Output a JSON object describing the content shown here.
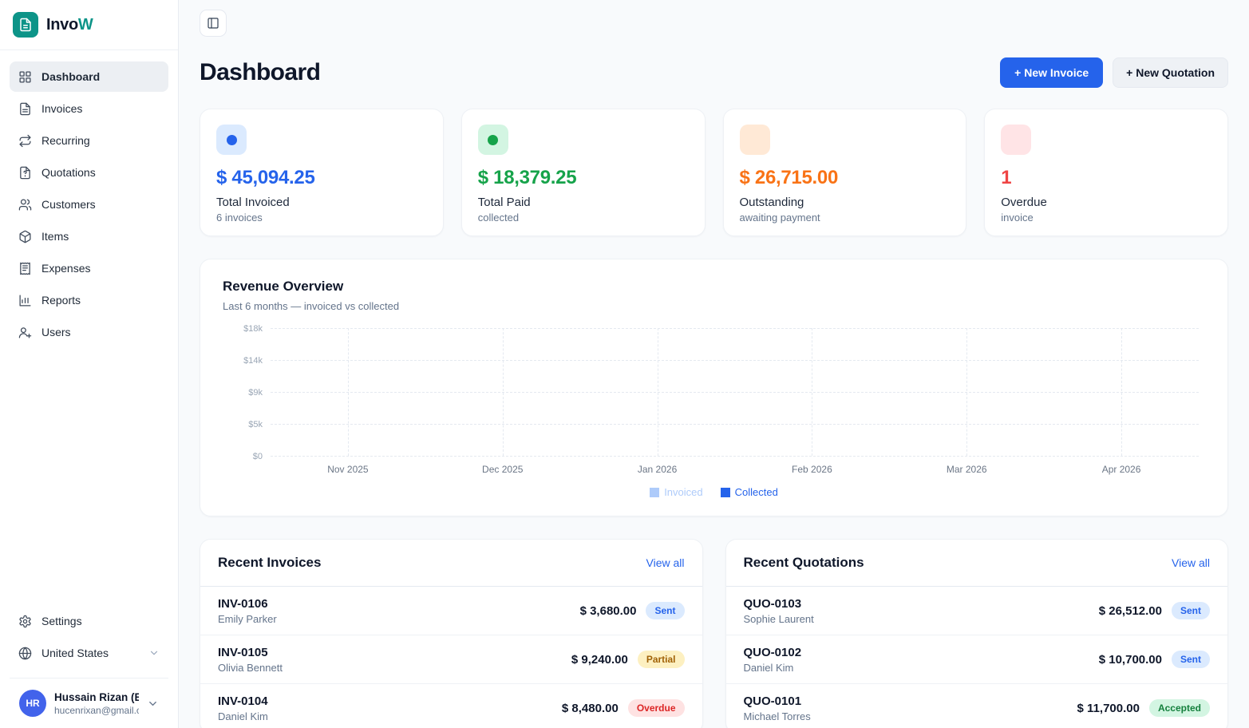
{
  "app": {
    "logo_primary": "Invo",
    "logo_secondary": "W"
  },
  "theme": {
    "brand_teal": "#0d9488",
    "primary_blue": "#2563eb"
  },
  "sidebar": {
    "items": [
      {
        "label": "Dashboard",
        "active": true
      },
      {
        "label": "Invoices"
      },
      {
        "label": "Recurring"
      },
      {
        "label": "Quotations"
      },
      {
        "label": "Customers"
      },
      {
        "label": "Items"
      },
      {
        "label": "Expenses"
      },
      {
        "label": "Reports"
      },
      {
        "label": "Users"
      }
    ],
    "settings_label": "Settings",
    "locale": "United States",
    "user": {
      "name": "Hussain Rizan (E...",
      "email": "hucenrixan@gmail.c...",
      "initials": "HR"
    }
  },
  "header": {
    "title": "Dashboard",
    "new_invoice_label": "+ New Invoice",
    "new_quotation_label": "+ New Quotation"
  },
  "stats": [
    {
      "value": "$ 45,094.25",
      "label": "Total Invoiced",
      "sub": "6 invoices",
      "accent": "#2563eb",
      "icon_bg": "#dbeafe"
    },
    {
      "value": "$ 18,379.25",
      "label": "Total Paid",
      "sub": "collected",
      "accent": "#16a34a",
      "icon_bg": "#d3f5e2"
    },
    {
      "value": "$ 26,715.00",
      "label": "Outstanding",
      "sub": "awaiting payment",
      "accent": "#f97316",
      "icon_bg": "#ffe9d6"
    },
    {
      "value": "1",
      "label": "Overdue",
      "sub": "invoice",
      "accent": "#ef4444",
      "icon_bg": "#ffe4e6"
    }
  ],
  "chart": {
    "title": "Revenue Overview",
    "subtitle": "Last 6 months — invoiced vs collected",
    "y_ticks": [
      "$18k",
      "$14k",
      "$9k",
      "$5k",
      "$0"
    ],
    "x_ticks": [
      "Nov 2025",
      "Dec 2025",
      "Jan 2026",
      "Feb 2026",
      "Mar 2026",
      "Apr 2026"
    ],
    "legend": [
      {
        "label": "Invoiced",
        "color": "#aecbfa"
      },
      {
        "label": "Collected",
        "color": "#2563eb"
      }
    ]
  },
  "chart_data": {
    "type": "bar",
    "title": "Revenue Overview",
    "subtitle": "Last 6 months — invoiced vs collected",
    "categories": [
      "Nov 2025",
      "Dec 2025",
      "Jan 2026",
      "Feb 2026",
      "Mar 2026",
      "Apr 2026"
    ],
    "series": [
      {
        "name": "Invoiced",
        "values": [
          0,
          0,
          0,
          0,
          0,
          0
        ]
      },
      {
        "name": "Collected",
        "values": [
          0,
          0,
          0,
          0,
          0,
          0
        ]
      }
    ],
    "ylim": [
      0,
      18000
    ],
    "y_tick_labels": [
      "$0",
      "$5k",
      "$9k",
      "$14k",
      "$18k"
    ],
    "grid": true,
    "legend_position": "bottom"
  },
  "recent_invoices": {
    "title": "Recent Invoices",
    "view_all": "View all",
    "rows": [
      {
        "code": "INV-0106",
        "customer": "Emily Parker",
        "amount": "$ 3,680.00",
        "status": "Sent"
      },
      {
        "code": "INV-0105",
        "customer": "Olivia Bennett",
        "amount": "$ 9,240.00",
        "status": "Partial"
      },
      {
        "code": "INV-0104",
        "customer": "Daniel Kim",
        "amount": "$ 8,480.00",
        "status": "Overdue"
      }
    ]
  },
  "recent_quotations": {
    "title": "Recent Quotations",
    "view_all": "View all",
    "rows": [
      {
        "code": "QUO-0103",
        "customer": "Sophie Laurent",
        "amount": "$ 26,512.00",
        "status": "Sent"
      },
      {
        "code": "QUO-0102",
        "customer": "Daniel Kim",
        "amount": "$ 10,700.00",
        "status": "Sent"
      },
      {
        "code": "QUO-0101",
        "customer": "Michael Torres",
        "amount": "$ 11,700.00",
        "status": "Accepted"
      }
    ]
  }
}
